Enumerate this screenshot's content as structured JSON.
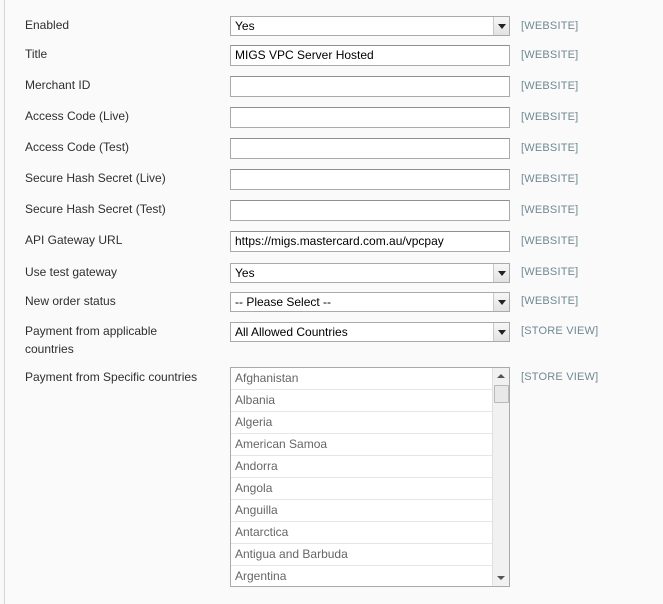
{
  "fields": [
    {
      "label": "Enabled",
      "type": "select",
      "value": "Yes",
      "scope": "[WEBSITE]"
    },
    {
      "label": "Title",
      "type": "text",
      "value": "MIGS VPC Server Hosted",
      "scope": "[WEBSITE]"
    },
    {
      "label": "Merchant ID",
      "type": "text",
      "value": "",
      "scope": "[WEBSITE]"
    },
    {
      "label": "Access Code (Live)",
      "type": "text",
      "value": "",
      "scope": "[WEBSITE]"
    },
    {
      "label": "Access Code (Test)",
      "type": "text",
      "value": "",
      "scope": "[WEBSITE]"
    },
    {
      "label": "Secure Hash Secret (Live)",
      "type": "text",
      "value": "",
      "scope": "[WEBSITE]"
    },
    {
      "label": "Secure Hash Secret (Test)",
      "type": "text",
      "value": "",
      "scope": "[WEBSITE]"
    },
    {
      "label": "API Gateway URL",
      "type": "text",
      "value": "https://migs.mastercard.com.au/vpcpay",
      "scope": "[WEBSITE]"
    },
    {
      "label": "Use test gateway",
      "type": "select",
      "value": "Yes",
      "scope": "[WEBSITE]"
    },
    {
      "label": "New order status",
      "type": "select",
      "value": "-- Please Select --",
      "scope": "[WEBSITE]"
    },
    {
      "label_line1": "Payment from applicable",
      "label_line2": "countries",
      "type": "select",
      "value": "All Allowed Countries",
      "scope": "[STORE VIEW]"
    }
  ],
  "specific_countries": {
    "label": "Payment from Specific countries",
    "scope": "[STORE VIEW]",
    "options": [
      "Afghanistan",
      "Albania",
      "Algeria",
      "American Samoa",
      "Andorra",
      "Angola",
      "Anguilla",
      "Antarctica",
      "Antigua and Barbuda",
      "Argentina"
    ]
  },
  "icons": {
    "dropdown": "chevron-down-icon",
    "scroll_up": "scroll-up-arrow-icon",
    "scroll_down": "scroll-down-arrow-icon"
  }
}
